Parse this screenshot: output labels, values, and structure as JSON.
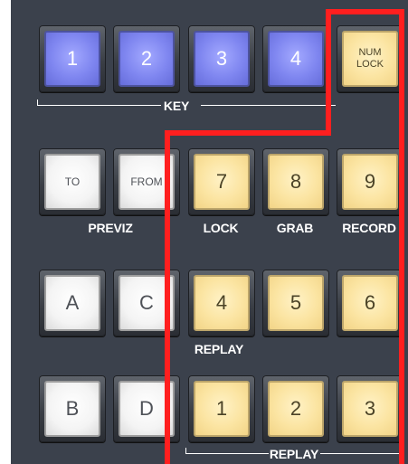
{
  "top_row": [
    {
      "label": "1"
    },
    {
      "label": "2"
    },
    {
      "label": "3"
    },
    {
      "label": "4"
    },
    {
      "label_line1": "NUM",
      "label_line2": "LOCK"
    }
  ],
  "key_group_label": "KEY",
  "row2": [
    {
      "label": "TO"
    },
    {
      "label": "FROM"
    },
    {
      "label": "7"
    },
    {
      "label": "8"
    },
    {
      "label": "9"
    }
  ],
  "row2_labels": {
    "previz": "PREVIZ",
    "lock": "LOCK",
    "grab": "GRAB",
    "record": "RECORD"
  },
  "row3": [
    {
      "label": "A"
    },
    {
      "label": "C"
    },
    {
      "label": "4"
    },
    {
      "label": "5"
    },
    {
      "label": "6"
    }
  ],
  "row3_label": "REPLAY",
  "row4": [
    {
      "label": "B"
    },
    {
      "label": "D"
    },
    {
      "label": "1"
    },
    {
      "label": "2"
    },
    {
      "label": "3"
    }
  ],
  "row4_label": "REPLAY",
  "colors": {
    "panel_bg": "#3b414c",
    "blue_key": "#8d93f4",
    "yellow_key": "#fbe4a1",
    "white_key": "#f4f4f4",
    "highlight": "#ff1f1f"
  }
}
